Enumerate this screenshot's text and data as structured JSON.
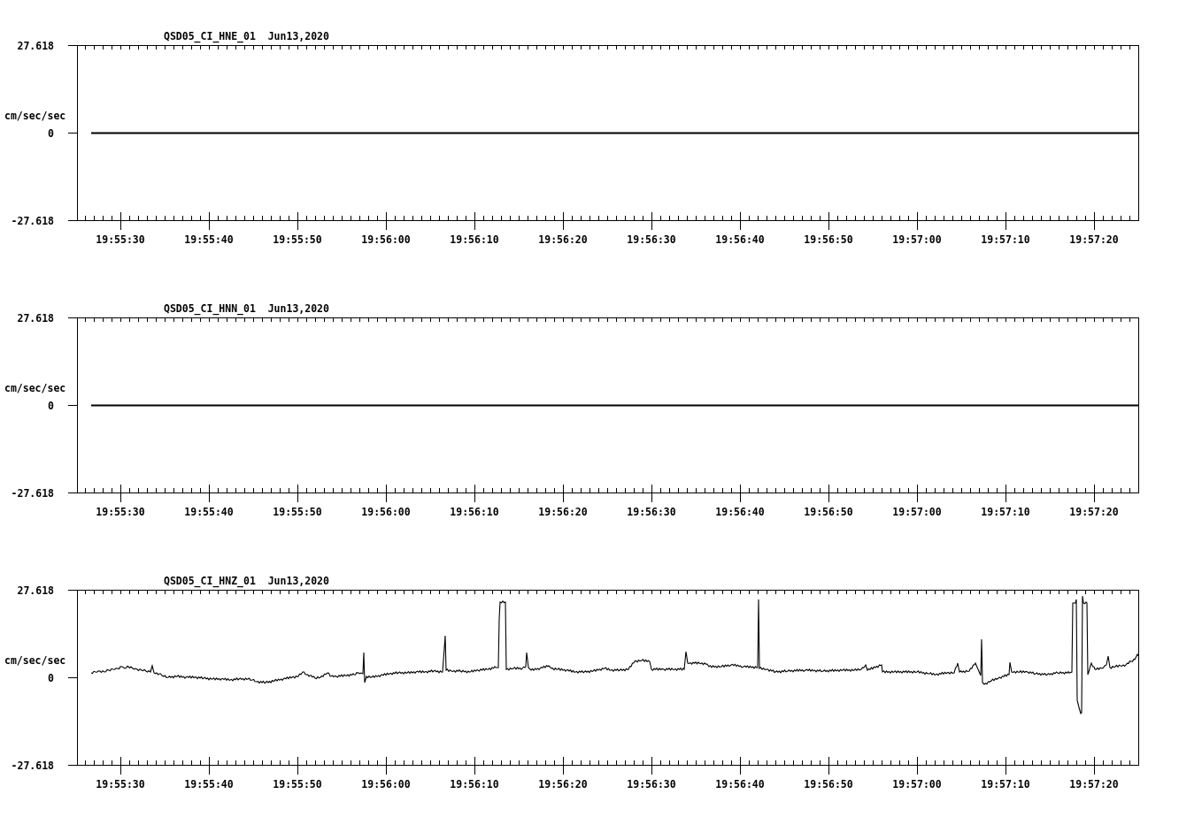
{
  "panels": [
    {
      "kind": "flat",
      "title": "QSD05_CI_HNE_01  Jun13,2020",
      "y_axis": {
        "label": "cm/sec/sec",
        "ticks": [
          "27.618",
          "0",
          "-27.618"
        ]
      },
      "x_axis": {
        "ticks": [
          "19:55:30",
          "19:55:40",
          "19:55:50",
          "19:56:00",
          "19:56:10",
          "19:56:20",
          "19:56:30",
          "19:56:40",
          "19:56:50",
          "19:57:00",
          "19:57:10",
          "19:57:20"
        ]
      }
    },
    {
      "kind": "flat",
      "title": "QSD05_CI_HNN_01  Jun13,2020",
      "y_axis": {
        "label": "cm/sec/sec",
        "ticks": [
          "27.618",
          "0",
          "-27.618"
        ]
      },
      "x_axis": {
        "ticks": [
          "19:55:30",
          "19:55:40",
          "19:55:50",
          "19:56:00",
          "19:56:10",
          "19:56:20",
          "19:56:30",
          "19:56:40",
          "19:56:50",
          "19:57:00",
          "19:57:10",
          "19:57:20"
        ]
      }
    },
    {
      "kind": "waveform",
      "title": "QSD05_CI_HNZ_01  Jun13,2020",
      "y_axis": {
        "label": "cm/sec/sec",
        "ticks": [
          "27.618",
          "0",
          "-27.618"
        ]
      },
      "x_axis": {
        "ticks": [
          "19:55:30",
          "19:55:40",
          "19:55:50",
          "19:56:00",
          "19:56:10",
          "19:56:20",
          "19:56:30",
          "19:56:40",
          "19:56:50",
          "19:57:00",
          "19:57:10",
          "19:57:20"
        ]
      }
    }
  ]
}
